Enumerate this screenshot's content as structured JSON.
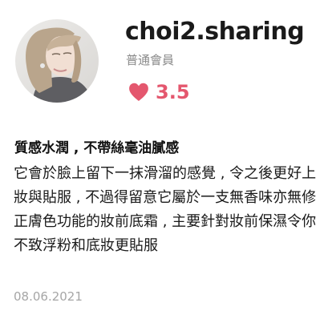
{
  "profile": {
    "username": "choi2.sharing",
    "member_level": "普通會員",
    "rating": "3.5",
    "rating_icon": "heart-icon",
    "accent_color": "#e4576e"
  },
  "review": {
    "title": "質感水潤 , 不帶絲毫油膩感",
    "body": "它會於臉上留下一抹滑溜的感覺 , 令之後更好上妝與貼服 , 不過得留意它屬於一支無香味亦無修正膚色功能的妝前底霜 , 主要針對妝前保濕令你不致浮粉和底妝更貼服",
    "date": "08.06.2021"
  }
}
